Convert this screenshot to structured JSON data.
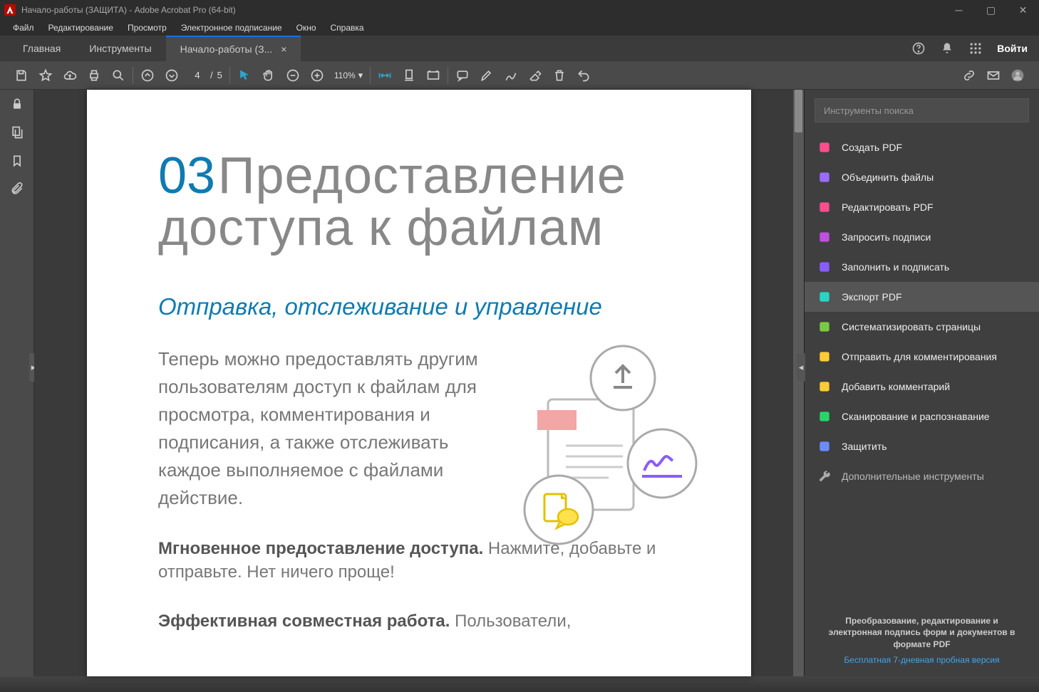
{
  "titlebar": {
    "title": "Начало-работы (ЗАЩИТА) - Adobe Acrobat Pro (64-bit)"
  },
  "menu": {
    "items": [
      "Файл",
      "Редактирование",
      "Просмотр",
      "Электронное подписание",
      "Окно",
      "Справка"
    ]
  },
  "tabs": {
    "home": "Главная",
    "tools": "Инструменты",
    "doc": "Начало-работы (З...",
    "signin": "Войти"
  },
  "toolbar": {
    "page_current": "4",
    "page_sep": "/",
    "page_total": "5",
    "zoom": "110%"
  },
  "doc": {
    "section_num": "03",
    "title1": "Предоставление",
    "title2": "доступа к файлам",
    "subtitle": "Отправка, отслеживание и управление",
    "body": "Теперь можно предоставлять другим пользователям доступ к файлам для просмотра, комментирования и подписания, а также отслеживать каждое выполняемое с файлами действие.",
    "p2b": "Мгновенное предоставление доступа.",
    "p2t": " Нажмите, добавьте и отправьте. Нет ничего проще!",
    "p3b": "Эффективная совместная работа.",
    "p3t": " Пользователи,"
  },
  "right": {
    "search_placeholder": "Инструменты поиска",
    "tools": [
      {
        "label": "Создать PDF",
        "color": "#ff4d8d"
      },
      {
        "label": "Объединить файлы",
        "color": "#9a6cff"
      },
      {
        "label": "Редактировать PDF",
        "color": "#ff4d8d"
      },
      {
        "label": "Запросить подписи",
        "color": "#c050e0"
      },
      {
        "label": "Заполнить и подписать",
        "color": "#8a5cff"
      },
      {
        "label": "Экспорт PDF",
        "color": "#2ad4c5",
        "active": true
      },
      {
        "label": "Систематизировать страницы",
        "color": "#7ac943"
      },
      {
        "label": "Отправить для комментирования",
        "color": "#ffcc33"
      },
      {
        "label": "Добавить комментарий",
        "color": "#ffcc33"
      },
      {
        "label": "Сканирование и распознавание",
        "color": "#2ad46a"
      },
      {
        "label": "Защитить",
        "color": "#6a8cff"
      }
    ],
    "more": "Дополнительные инструменты",
    "promo": "Преобразование, редактирование и электронная подпись форм и документов в формате PDF",
    "trial": "Бесплатная 7-дневная пробная версия"
  }
}
